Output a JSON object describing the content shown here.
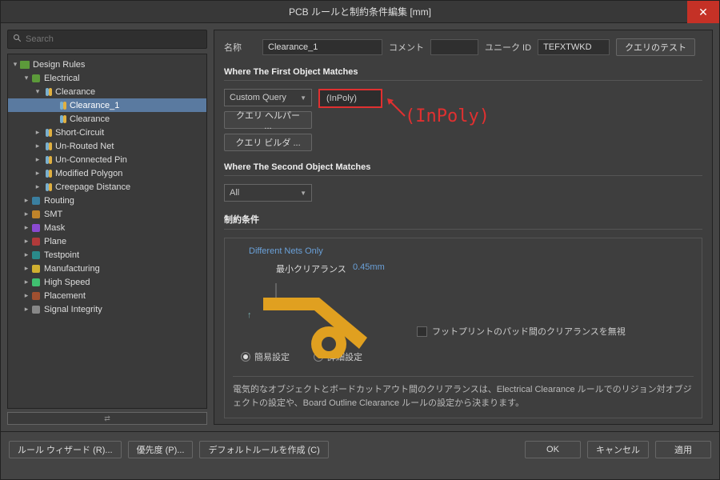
{
  "window": {
    "title": "PCB ルールと制約条件編集 [mm]"
  },
  "search": {
    "placeholder": "Search"
  },
  "tree": {
    "root": "Design Rules",
    "electrical": "Electrical",
    "clearance": "Clearance",
    "clearance_1": "Clearance_1",
    "clearance_child": "Clearance",
    "short_circuit": "Short-Circuit",
    "unrouted_net": "Un-Routed Net",
    "unconnected_pin": "Un-Connected Pin",
    "modified_polygon": "Modified Polygon",
    "creepage": "Creepage Distance",
    "routing": "Routing",
    "smt": "SMT",
    "mask": "Mask",
    "plane": "Plane",
    "testpoint": "Testpoint",
    "manufacturing": "Manufacturing",
    "high_speed": "High Speed",
    "placement": "Placement",
    "signal_integrity": "Signal Integrity"
  },
  "form": {
    "name_label": "名称",
    "name_value": "Clearance_1",
    "comment_label": "コメント",
    "comment_value": "",
    "unique_id_label": "ユニーク ID",
    "unique_id_value": "TEFXTWKD",
    "test_query_btn": "クエリのテスト"
  },
  "first_match": {
    "title": "Where The First Object Matches",
    "scope": "Custom Query",
    "query_value": "(InPoly)",
    "helper_btn": "クエリ ヘルパー ...",
    "builder_btn": "クエリ ビルダ ..."
  },
  "annotation": {
    "text": "(InPoly)"
  },
  "second_match": {
    "title": "Where The Second Object Matches",
    "scope": "All"
  },
  "constraints": {
    "title": "制約条件",
    "different_nets": "Different Nets Only",
    "min_clearance_label": "最小クリアランス",
    "min_clearance_value": "0.45mm",
    "ignore_pad_label": "フットプリントのパッド間のクリアランスを無視",
    "simple_label": "簡易設定",
    "advanced_label": "詳細設定",
    "note": "電気的なオブジェクトとボードカットアウト間のクリアランスは、Electrical Clearance ルールでのリジョン対オブジェクトの設定や、Board Outline Clearance ルールの設定から決まります。"
  },
  "footer": {
    "wizard": "ルール ウィザード (R)...",
    "priority": "優先度 (P)...",
    "default": "デフォルトルールを作成 (C)",
    "ok": "OK",
    "cancel": "キャンセル",
    "apply": "適用"
  }
}
